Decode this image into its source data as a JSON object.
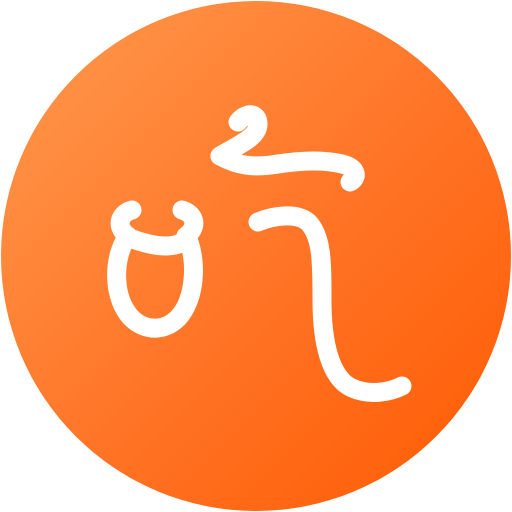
{
  "logo": {
    "icon": "stylized-glyph-logo-icon",
    "background_gradient": [
      "#FF8C42",
      "#FF6A10",
      "#FF5A00"
    ],
    "glyph_color": "#FFFFFF"
  }
}
